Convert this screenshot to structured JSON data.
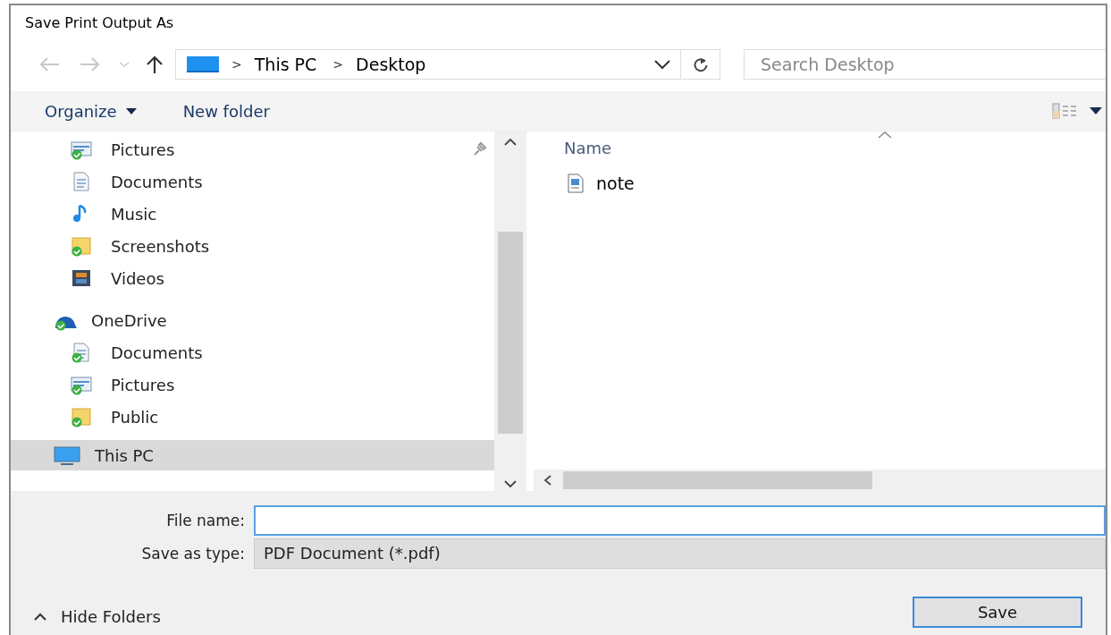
{
  "window": {
    "title": "Save Print Output As"
  },
  "address_bar": {
    "path": [
      "This PC",
      "Desktop"
    ],
    "separator": ">"
  },
  "search": {
    "placeholder": "Search Desktop"
  },
  "toolbar": {
    "organize": "Organize",
    "new_folder": "New folder"
  },
  "nav_tree": [
    {
      "children": [
        {
          "label": "Pictures",
          "kind": "pictures",
          "synced": true,
          "pinned": true,
          "selected": false
        },
        {
          "label": "Documents",
          "kind": "documents",
          "synced": false,
          "pinned": false,
          "selected": false
        },
        {
          "label": "Music",
          "kind": "music",
          "synced": false,
          "pinned": false,
          "selected": false
        },
        {
          "label": "Screenshots",
          "kind": "folder",
          "synced": true,
          "pinned": false,
          "selected": false
        },
        {
          "label": "Videos",
          "kind": "videos",
          "synced": false,
          "pinned": false,
          "selected": false
        }
      ]
    },
    {
      "label": "OneDrive",
      "kind": "cloud",
      "synced": true,
      "pinned": false,
      "selected": false,
      "children": [
        {
          "label": "Documents",
          "kind": "documents",
          "synced": true,
          "pinned": false,
          "selected": false
        },
        {
          "label": "Pictures",
          "kind": "pictures",
          "synced": true,
          "pinned": false,
          "selected": false
        },
        {
          "label": "Public",
          "kind": "folder",
          "synced": true,
          "pinned": false,
          "selected": false
        }
      ]
    },
    {
      "label": "This PC",
      "kind": "computer",
      "synced": false,
      "pinned": false,
      "selected": true
    }
  ],
  "file_list": {
    "columns": [
      "Name"
    ],
    "files": [
      {
        "name": "note"
      }
    ]
  },
  "form": {
    "file_name_label": "File name:",
    "type_label": "Save as type:",
    "type_value": "PDF Document (*.pdf)"
  },
  "hide_folders": "Hide Folders",
  "buttons": [
    "Save"
  ]
}
